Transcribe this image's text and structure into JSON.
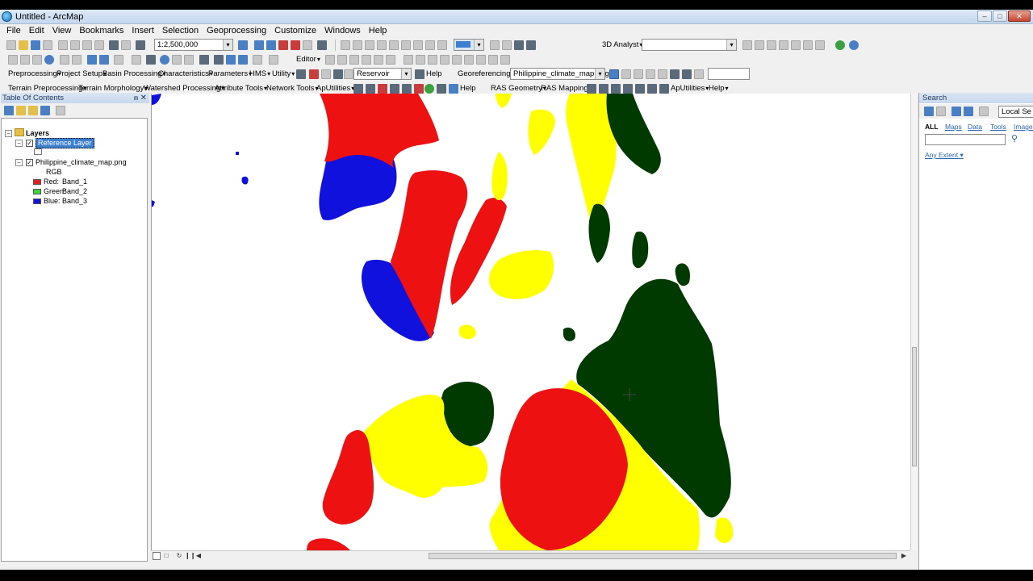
{
  "window": {
    "title": "Untitled - ArcMap",
    "min_label": "–",
    "max_label": "□",
    "close_label": "✕"
  },
  "menus": [
    "File",
    "Edit",
    "View",
    "Bookmarks",
    "Insert",
    "Selection",
    "Geoprocessing",
    "Customize",
    "Windows",
    "Help"
  ],
  "toolbar1": {
    "scale": "1:2,500,000",
    "analyst": "3D Analyst",
    "analyst_layer": ""
  },
  "toolbar2": {
    "editor": "Editor"
  },
  "toolbar3": {
    "items": [
      "Preprocessing",
      "Project Setup",
      "Basin Processing",
      "Characteristics",
      "Parameters",
      "HMS",
      "Utility"
    ],
    "reservoir": "Reservoir",
    "help": "Help",
    "georeferencing": "Georeferencing",
    "geo_layer": "Philippine_climate_map.png",
    "geo_value": ""
  },
  "toolbar4": {
    "items": [
      "Terrain Preprocessing",
      "Terrain Morphology",
      "Watershed Processing",
      "Attribute Tools",
      "Network Tools",
      "ApUtilities"
    ],
    "help": "Help",
    "ras_geometry": "RAS Geometry",
    "ras_mapping": "RAS Mapping",
    "aputilities2": "ApUtilities",
    "help2": "Help"
  },
  "toc": {
    "title": "Table Of Contents",
    "pin": "⩎",
    "close": "✕",
    "layers_label": "Layers",
    "reference_layer": "Reference Layer",
    "raster_layer": "Philippine_climate_map.png",
    "rgb_label": "RGB",
    "bands": [
      {
        "channel": "Red:",
        "band": "Band_1",
        "color": "#e02020"
      },
      {
        "channel": "Green:",
        "band": "Band_2",
        "color": "#3cd23c"
      },
      {
        "channel": "Blue:",
        "band": "Band_3",
        "color": "#1414d2"
      }
    ]
  },
  "search": {
    "title": "Search",
    "local": "Local Se",
    "tabs": [
      "ALL",
      "Maps",
      "Data",
      "Tools",
      "Images"
    ],
    "query": "",
    "extent": "Any Extent"
  },
  "map": {
    "colors": {
      "red": "#ee1111",
      "blue": "#1111dd",
      "yellow": "#ffff00",
      "green": "#003a00"
    }
  }
}
